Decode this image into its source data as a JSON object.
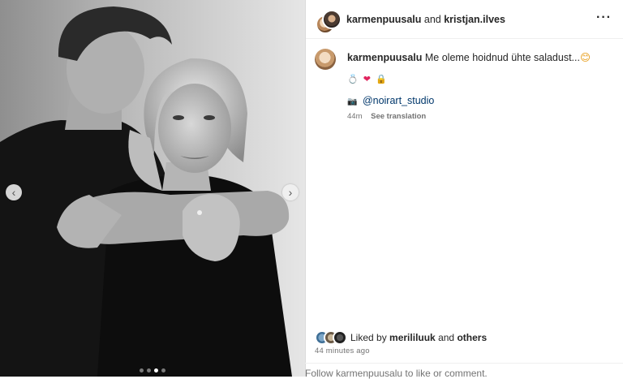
{
  "header": {
    "user1": "karmenpuusalu",
    "joiner": "and",
    "user2": "kristjan.ilves",
    "more_icon": "more-horizontal-icon"
  },
  "caption": {
    "username": "karmenpuusalu",
    "text": "Me oleme hoidnud ühte saladust...",
    "emoji_end": "😊",
    "emoji_row": [
      "💍",
      "❤",
      "🔒"
    ],
    "mention_emoji": "📷",
    "mention": "@noirart_studio",
    "age": "44m",
    "see_translation": "See translation"
  },
  "likes": {
    "prefix": "Liked by",
    "user": "merililuuk",
    "joiner": "and",
    "others": "others",
    "time_ago": "44 minutes ago"
  },
  "footer": {
    "text": "Follow karmenpuusalu to like or comment."
  },
  "media": {
    "carousel_count": 4,
    "active_index": 2,
    "prev_icon": "chevron-left-icon",
    "next_icon": "chevron-right-icon"
  },
  "colors": {
    "text": "#262626",
    "muted": "#737373",
    "link": "#00376b",
    "heart": "#e0245e"
  }
}
